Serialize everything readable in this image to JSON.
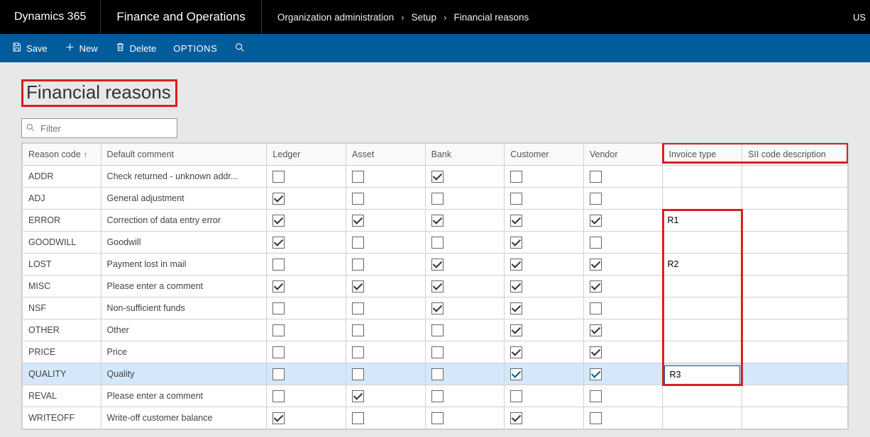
{
  "topbar": {
    "brand": "Dynamics 365",
    "app_title": "Finance and Operations",
    "breadcrumb": [
      "Organization administration",
      "Setup",
      "Financial reasons"
    ],
    "user": "US"
  },
  "actionbar": {
    "save": "Save",
    "new": "New",
    "delete": "Delete",
    "options": "OPTIONS"
  },
  "page": {
    "title": "Financial reasons",
    "filter_placeholder": "Filter"
  },
  "columns": {
    "reason": "Reason code",
    "comment": "Default comment",
    "ledger": "Ledger",
    "asset": "Asset",
    "bank": "Bank",
    "customer": "Customer",
    "vendor": "Vendor",
    "invoice_type": "Invoice type",
    "sii": "SII code description"
  },
  "rows": [
    {
      "code": "ADDR",
      "comment": "Check returned - unknown addr...",
      "ledger": false,
      "asset": false,
      "bank": true,
      "customer": false,
      "vendor": false,
      "invoice": "",
      "sii": "",
      "selected": false
    },
    {
      "code": "ADJ",
      "comment": "General adjustment",
      "ledger": true,
      "asset": false,
      "bank": false,
      "customer": false,
      "vendor": false,
      "invoice": "",
      "sii": "",
      "selected": false
    },
    {
      "code": "ERROR",
      "comment": "Correction of data entry error",
      "ledger": true,
      "asset": true,
      "bank": true,
      "customer": true,
      "vendor": true,
      "invoice": "R1",
      "sii": "",
      "selected": false
    },
    {
      "code": "GOODWILL",
      "comment": "Goodwill",
      "ledger": true,
      "asset": false,
      "bank": false,
      "customer": true,
      "vendor": false,
      "invoice": "",
      "sii": "",
      "selected": false
    },
    {
      "code": "LOST",
      "comment": "Payment lost in mail",
      "ledger": false,
      "asset": false,
      "bank": true,
      "customer": true,
      "vendor": true,
      "invoice": "R2",
      "sii": "",
      "selected": false
    },
    {
      "code": "MISC",
      "comment": "Please enter a comment",
      "ledger": true,
      "asset": true,
      "bank": true,
      "customer": true,
      "vendor": true,
      "invoice": "",
      "sii": "",
      "selected": false
    },
    {
      "code": "NSF",
      "comment": "Non-sufficient funds",
      "ledger": false,
      "asset": false,
      "bank": true,
      "customer": true,
      "vendor": false,
      "invoice": "",
      "sii": "",
      "selected": false
    },
    {
      "code": "OTHER",
      "comment": "Other",
      "ledger": false,
      "asset": false,
      "bank": false,
      "customer": true,
      "vendor": true,
      "invoice": "",
      "sii": "",
      "selected": false
    },
    {
      "code": "PRICE",
      "comment": "Price",
      "ledger": false,
      "asset": false,
      "bank": false,
      "customer": true,
      "vendor": true,
      "invoice": "",
      "sii": "",
      "selected": false
    },
    {
      "code": "QUALITY",
      "comment": "Quality",
      "ledger": false,
      "asset": false,
      "bank": false,
      "customer": true,
      "vendor": true,
      "invoice": "R3",
      "sii": "",
      "selected": true
    },
    {
      "code": "REVAL",
      "comment": "Please enter a comment",
      "ledger": false,
      "asset": true,
      "bank": false,
      "customer": false,
      "vendor": false,
      "invoice": "",
      "sii": "",
      "selected": false
    },
    {
      "code": "WRITEOFF",
      "comment": "Write-off customer balance",
      "ledger": true,
      "asset": false,
      "bank": false,
      "customer": true,
      "vendor": false,
      "invoice": "",
      "sii": "",
      "selected": false
    }
  ]
}
